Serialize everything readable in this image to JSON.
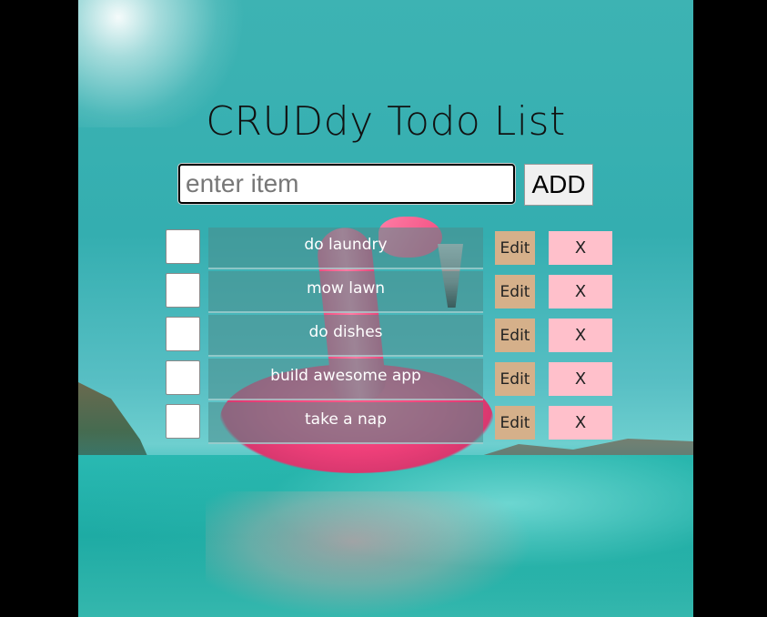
{
  "app": {
    "title": "CRUDdy Todo List"
  },
  "add_form": {
    "placeholder": "enter item",
    "value": "",
    "add_label": "ADD"
  },
  "todos": [
    {
      "text": "do laundry",
      "checked": false,
      "edit_label": "Edit",
      "delete_label": "X"
    },
    {
      "text": "mow lawn",
      "checked": false,
      "edit_label": "Edit",
      "delete_label": "X"
    },
    {
      "text": "do dishes",
      "checked": false,
      "edit_label": "Edit",
      "delete_label": "X"
    },
    {
      "text": "build awesome app",
      "checked": false,
      "edit_label": "Edit",
      "delete_label": "X"
    },
    {
      "text": "take a nap",
      "checked": false,
      "edit_label": "Edit",
      "delete_label": "X"
    }
  ],
  "colors": {
    "edit_button": "#d5b08a",
    "delete_button": "#ffc0cb",
    "item_background": "rgba(76,140,140,0.55)"
  }
}
